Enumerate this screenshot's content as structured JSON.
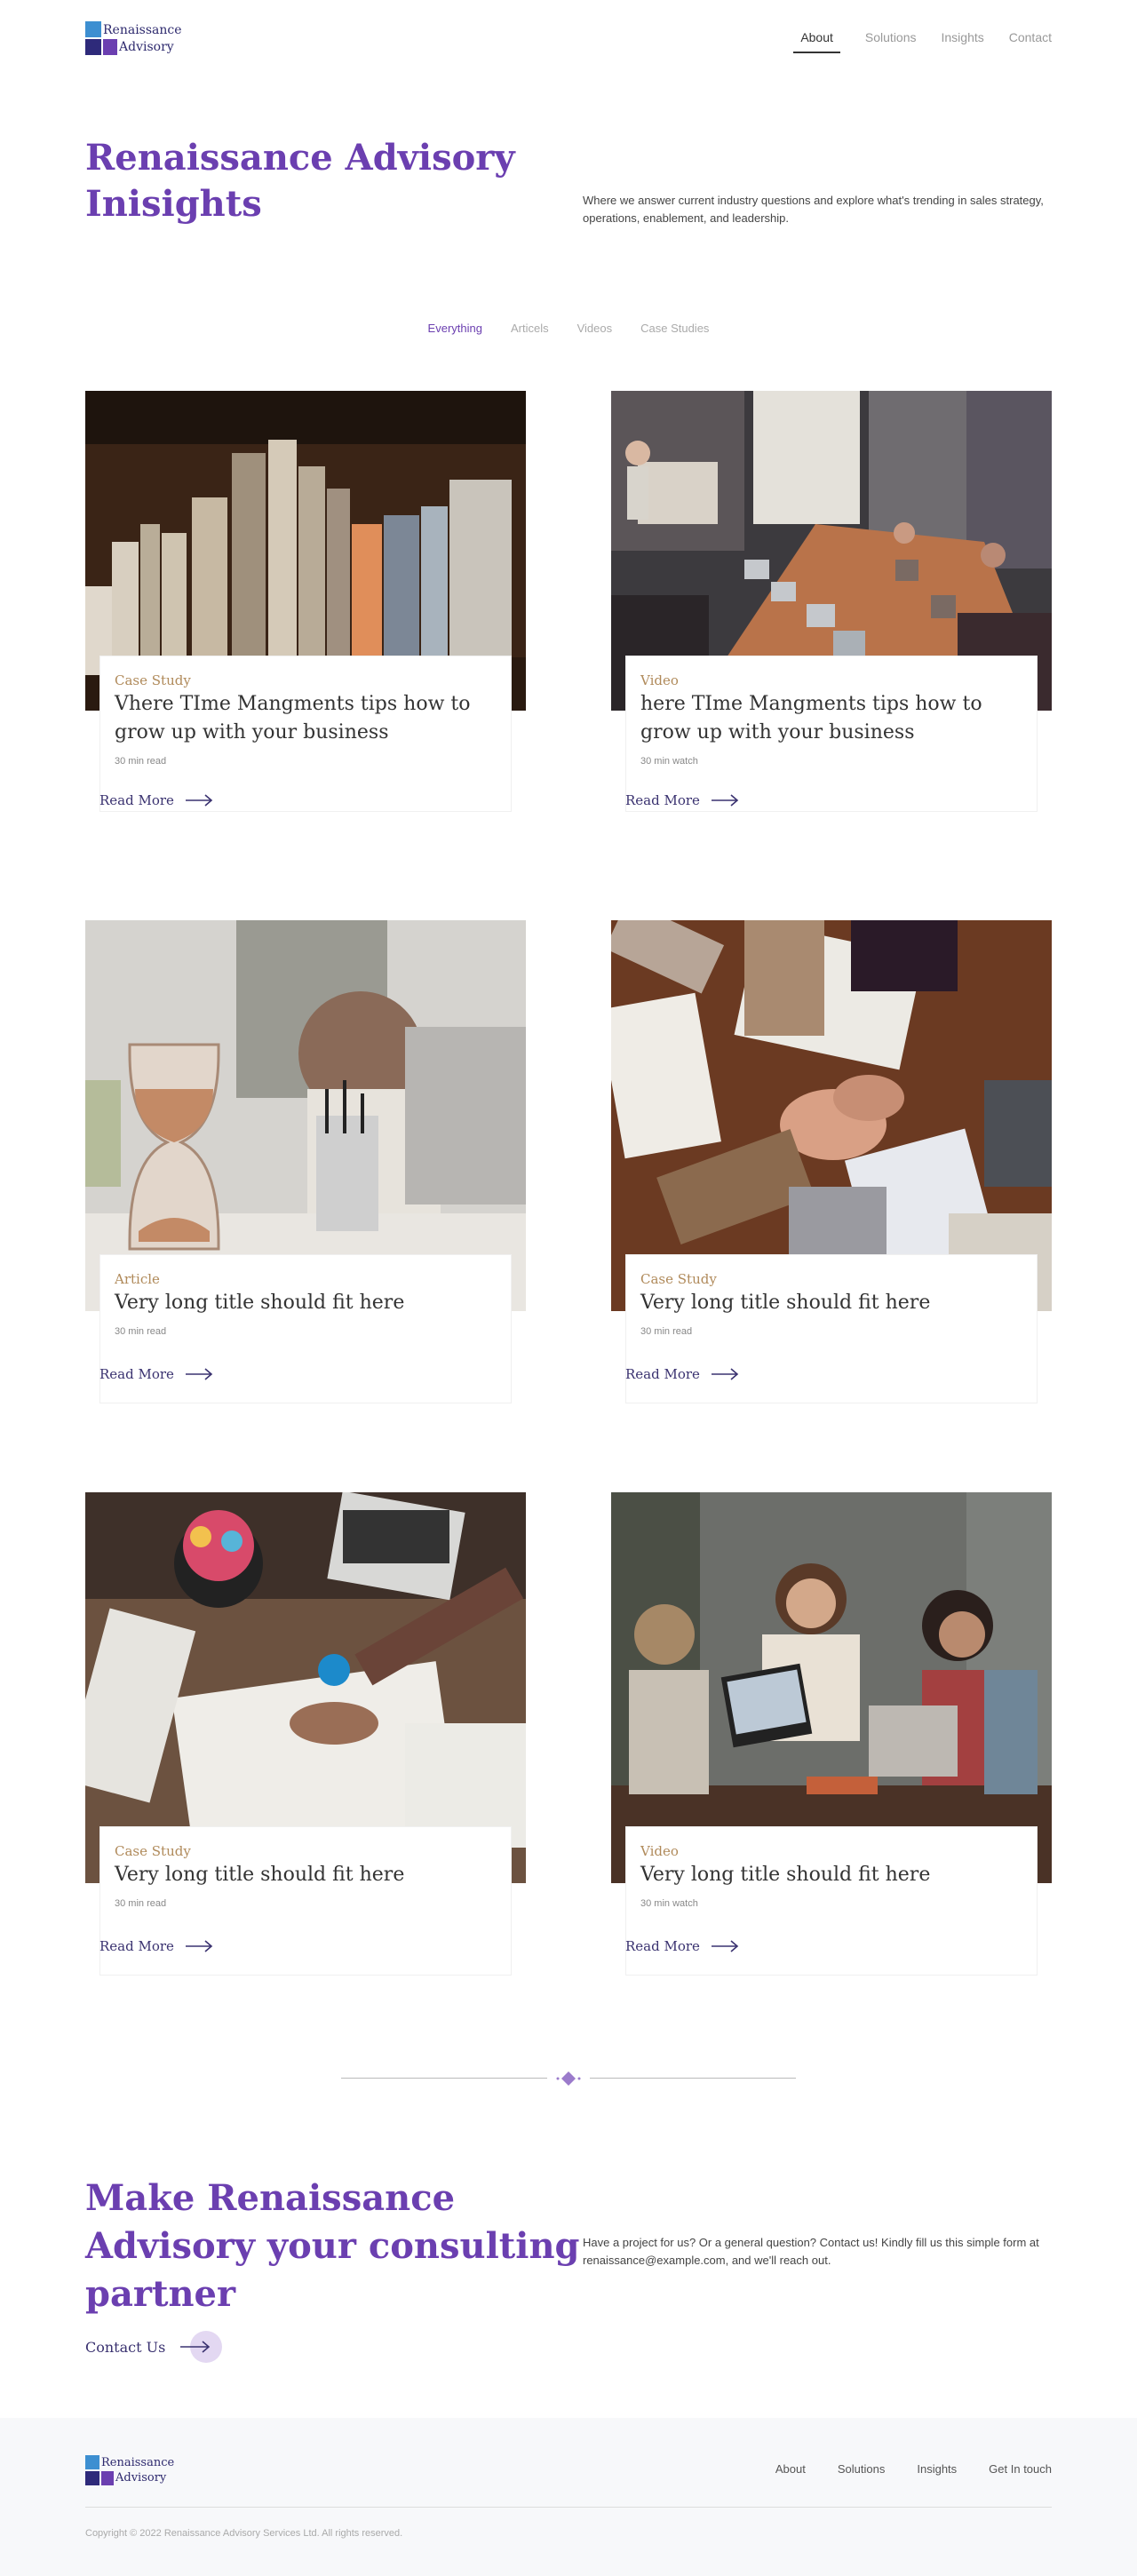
{
  "header": {
    "logo_line1": "Renaissance",
    "logo_line2": "Advisory",
    "nav": [
      "About",
      "Solutions",
      "Insights",
      "Contact"
    ]
  },
  "hero": {
    "title": "Renaissance Advisory Inisights",
    "description": "Where we answer current industry questions and explore what's trending in sales strategy, operations, enablement, and leadership."
  },
  "filters": [
    "Everything",
    "Articels",
    "Videos",
    "Case Studies"
  ],
  "cards": [
    {
      "category": "Case Study",
      "title": "Vhere TIme Mangments tips how to grow up with your business",
      "meta": "30 min read",
      "cta": "Read More"
    },
    {
      "category": "Video",
      "title": "here TIme Mangments tips how to grow up with your business",
      "meta": "30 min watch",
      "cta": "Read More"
    },
    {
      "category": "Article",
      "title": "Very long title should fit here",
      "meta": "30 min read",
      "cta": "Read More"
    },
    {
      "category": "Case Study",
      "title": "Very long title should fit here",
      "meta": "30 min read",
      "cta": "Read More"
    },
    {
      "category": "Case Study",
      "title": "Very long title should fit here",
      "meta": "30 min read",
      "cta": "Read More"
    },
    {
      "category": "Video",
      "title": "Very long title should fit here",
      "meta": "30 min watch",
      "cta": "Read More"
    }
  ],
  "cta": {
    "title": "Make Renaissance Advisory your consulting partner",
    "description": "Have a project for us? Or a general question? Contact us! Kindly fill us this simple form at renaissance@example.com, and we'll reach out.",
    "button": "Contact Us"
  },
  "footer": {
    "logo_line1": "Renaissance",
    "logo_line2": "Advisory",
    "nav": [
      "About",
      "Solutions",
      "Insights",
      "Get In touch"
    ],
    "copyright": "Copyright © 2022 Renaissance Advisory Services Ltd. All rights reserved."
  },
  "colors": {
    "brand_purple": "#6b3fb0",
    "brand_navy": "#2e2a6e",
    "category_tan": "#b08a5a",
    "brand_blue": "#3d8fd1"
  },
  "icons": [
    "arrow-right-icon",
    "diamond-icon"
  ]
}
